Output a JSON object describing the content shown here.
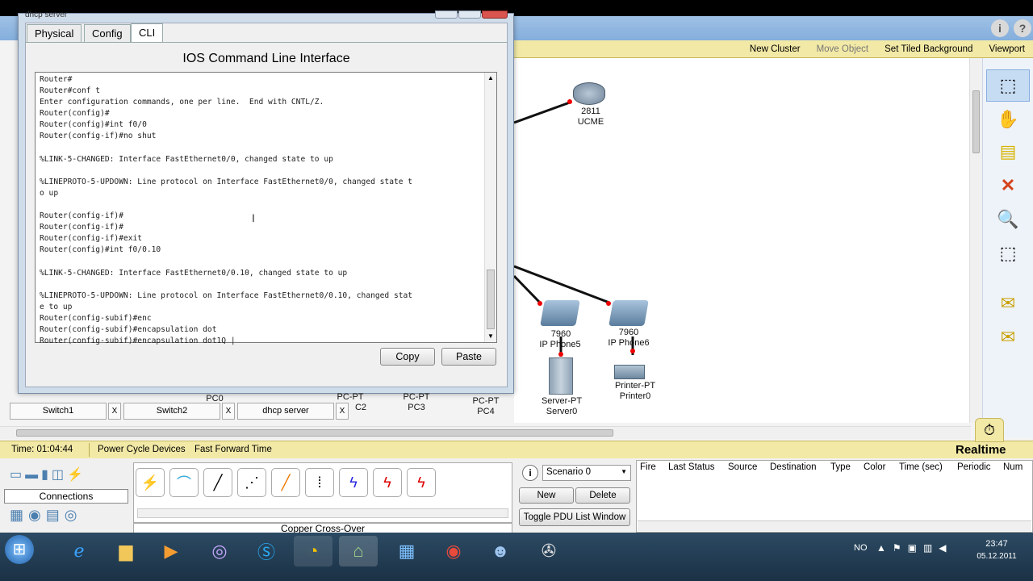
{
  "dialog": {
    "title": "dhcp server",
    "tabs": [
      "Physical",
      "Config",
      "CLI"
    ],
    "cli_header": "IOS Command Line Interface",
    "terminal_lines": [
      "Router#",
      "Router#conf t",
      "Enter configuration commands, one per line.  End with CNTL/Z.",
      "Router(config)#",
      "Router(config)#int f0/0",
      "Router(config-if)#no shut",
      "",
      "%LINK-5-CHANGED: Interface FastEthernet0/0, changed state to up",
      "",
      "%LINEPROTO-5-UPDOWN: Line protocol on Interface FastEthernet0/0, changed state t",
      "o up",
      "",
      "Router(config-if)#",
      "Router(config-if)#",
      "Router(config-if)#exit",
      "Router(config)#int f0/0.10",
      "",
      "%LINK-5-CHANGED: Interface FastEthernet0/0.10, changed state to up",
      "",
      "%LINEPROTO-5-UPDOWN: Line protocol on Interface FastEthernet0/0.10, changed stat",
      "e to up",
      "Router(config-subif)#enc",
      "Router(config-subif)#encapsulation dot",
      "Router(config-subif)#encapsulation dot1Q |"
    ],
    "copy_label": "Copy",
    "paste_label": "Paste"
  },
  "toolbar": {
    "new_cluster": "New Cluster",
    "move_object": "Move Object",
    "set_tiled_background": "Set Tiled Background",
    "viewport": "Viewport"
  },
  "devices": {
    "router_model": "2811",
    "router_name": "UCME",
    "phone5_model": "7960",
    "phone5_name": "IP Phone5",
    "phone6_model": "7960",
    "phone6_name": "IP Phone6",
    "server_type": "Server-PT",
    "server_name": "Server0",
    "printer_type": "Printer-PT",
    "printer_name": "Printer0",
    "pc0": "PC0",
    "pc2_type": "PC-PT",
    "pc2_name": "C2",
    "pc3_type": "PC-PT",
    "pc3_name": "PC3",
    "pc4_type": "PC-PT",
    "pc4_name": "PC4"
  },
  "window_tabs": [
    "Switch1",
    "Switch2",
    "dhcp server"
  ],
  "window_tab_close": "X",
  "status": {
    "time": "Time: 01:04:44",
    "power_cycle": "Power Cycle Devices",
    "fast_forward": "Fast Forward Time",
    "mode": "Realtime"
  },
  "bottom": {
    "connections_label": "Connections",
    "selected_connection": "Copper Cross-Over",
    "scenario": "Scenario 0",
    "new_label": "New",
    "delete_label": "Delete",
    "toggle_pdu": "Toggle PDU List Window",
    "pdu_columns": [
      "Fire",
      "Last Status",
      "Source",
      "Destination",
      "Type",
      "Color",
      "Time (sec)",
      "Periodic",
      "Num"
    ]
  },
  "taskbar": {
    "lang": "NO",
    "time": "23:47",
    "date": "05.12.2011"
  },
  "colors": {
    "status_yellow": "#f2e9a6",
    "link_red": "#e00000",
    "taskbar": "#1b3145"
  }
}
